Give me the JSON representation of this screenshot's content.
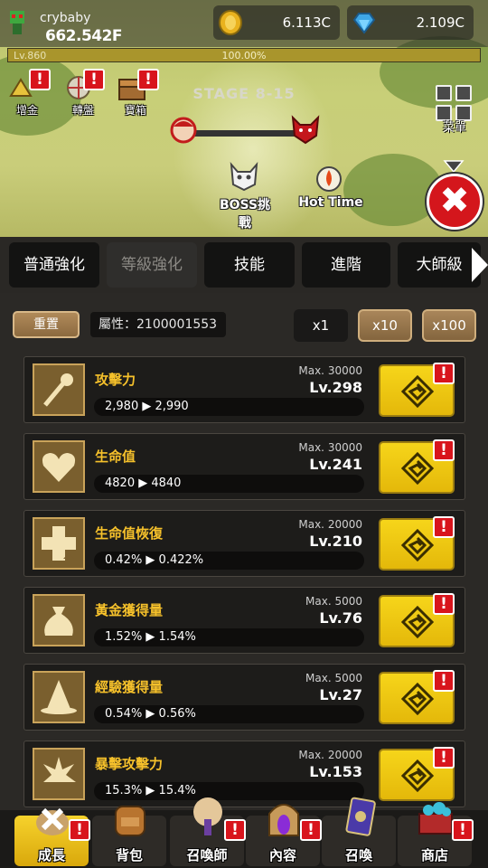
{
  "player": {
    "name": "crybaby",
    "power": "662.542F",
    "level": "Lv.860",
    "xp_percent_label": "100.00%",
    "xp_progress": 1.0
  },
  "currency": {
    "gold": "6.113C",
    "gems": "2.109C"
  },
  "scene": {
    "stage": "STAGE 8-15",
    "boss_label": "BOSS挑戰",
    "hot_time_label": "Hot Time",
    "left_buttons": [
      {
        "label": "增金",
        "icon": "gold-boost-icon"
      },
      {
        "label": "轉盤",
        "icon": "roulette-icon"
      },
      {
        "label": "寶箱",
        "icon": "treasure-chest-icon"
      }
    ],
    "menu_label": "菜單",
    "alert_symbol": "!"
  },
  "tabs": [
    {
      "label": "普通強化",
      "active": false
    },
    {
      "label": "等級強化",
      "active": true
    },
    {
      "label": "技能",
      "active": false
    },
    {
      "label": "進階",
      "active": false
    },
    {
      "label": "大師級",
      "active": false
    }
  ],
  "controls": {
    "reset_label": "重置",
    "attribute_label": "屬性：2100001553",
    "multipliers": [
      "x1",
      "x10",
      "x100"
    ]
  },
  "stats": [
    {
      "name": "攻擊力",
      "max": "Max. 30000",
      "level": "Lv.298",
      "change": "2,980 ▶ 2,990",
      "icon": "scepter-icon"
    },
    {
      "name": "生命值",
      "max": "Max. 30000",
      "level": "Lv.241",
      "change": "4820 ▶ 4840",
      "icon": "heart-icon"
    },
    {
      "name": "生命值恢復",
      "max": "Max. 20000",
      "level": "Lv.210",
      "change": "0.42% ▶ 0.422%",
      "icon": "health-cross-icon"
    },
    {
      "name": "黃金獲得量",
      "max": "Max. 5000",
      "level": "Lv.76",
      "change": "1.52% ▶ 1.54%",
      "icon": "gold-bag-icon"
    },
    {
      "name": "經驗獲得量",
      "max": "Max. 5000",
      "level": "Lv.27",
      "change": "0.54% ▶ 0.56%",
      "icon": "wizard-hat-icon"
    },
    {
      "name": "暴擊攻擊力",
      "max": "Max. 20000",
      "level": "Lv.153",
      "change": "15.3% ▶ 15.4%",
      "icon": "burst-icon"
    }
  ],
  "bottom_nav": [
    {
      "label": "成長",
      "icon": "growth-icon",
      "active": true
    },
    {
      "label": "背包",
      "icon": "backpack-icon",
      "active": false
    },
    {
      "label": "召喚師",
      "icon": "summoner-tree-icon",
      "active": false
    },
    {
      "label": "內容",
      "icon": "portal-gate-icon",
      "active": false
    },
    {
      "label": "召喚",
      "icon": "summon-card-icon",
      "active": false
    },
    {
      "label": "商店",
      "icon": "shop-chest-icon",
      "active": false
    }
  ],
  "colors": {
    "accent_gold": "#f6c12b",
    "alert_red": "#d8141c",
    "panel_bg": "#2b2926"
  }
}
